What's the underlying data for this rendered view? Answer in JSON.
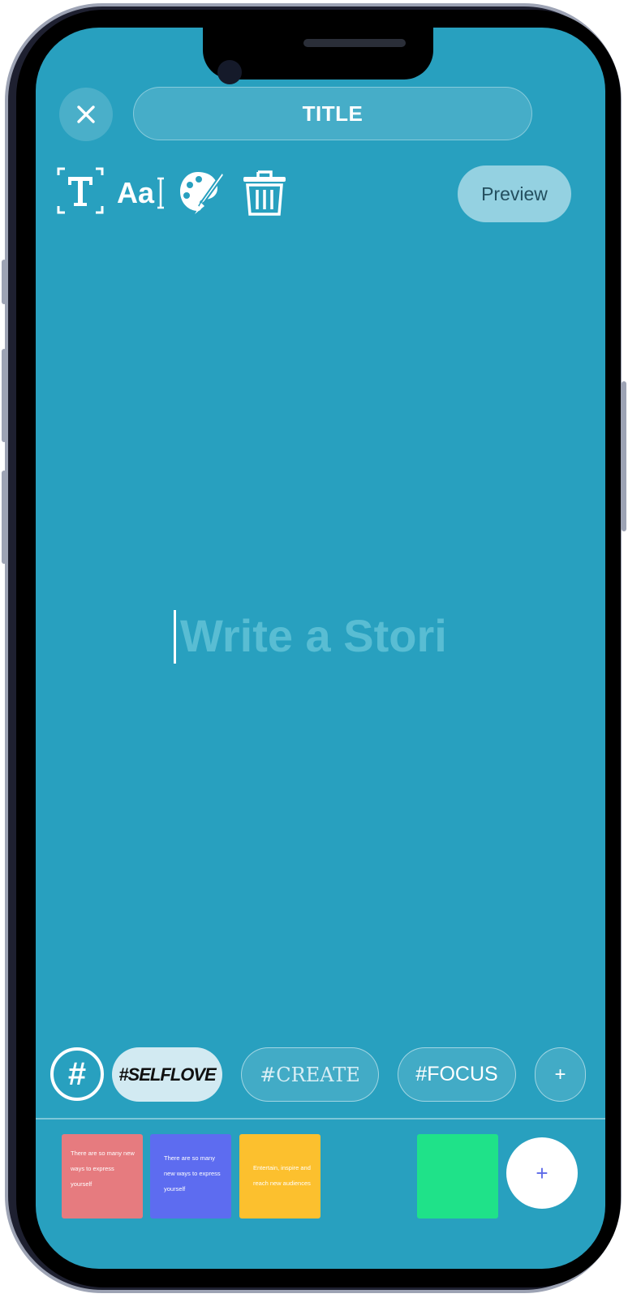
{
  "header": {
    "close_icon": "close-icon",
    "title_label": "TITLE"
  },
  "toolbar": {
    "icons": [
      "text-frame-icon",
      "font-size-icon",
      "palette-icon",
      "trash-icon"
    ],
    "preview_label": "Preview"
  },
  "editor": {
    "placeholder": "Write a Stori"
  },
  "hashtags": {
    "hash_icon": "hash-icon",
    "chips": [
      "#SELFLOVE",
      "#CREATE",
      "#FOCUS"
    ],
    "add_label": "+"
  },
  "templates": {
    "tiles": [
      {
        "text": "There are so many new ways to express yourself",
        "color": "#e67b7f"
      },
      {
        "text": "There are so many new ways to express yourself",
        "color": "#5d6cf0"
      },
      {
        "text": "Entertain, inspire and reach new audiences",
        "color": "#fcc02e"
      },
      {
        "text": "",
        "color": "#1fe289"
      }
    ],
    "add_label": "+"
  },
  "colors": {
    "background": "#28a0bf",
    "preview_button": "#94d1e1",
    "selected_chip": "#d2eaf2"
  }
}
